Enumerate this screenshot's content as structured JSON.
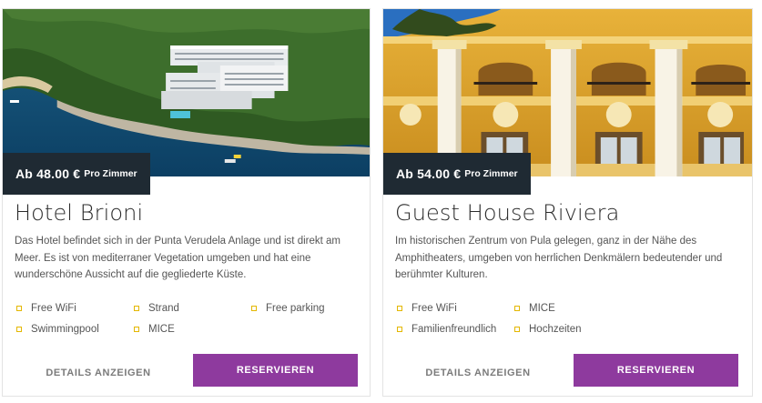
{
  "cards": [
    {
      "price": "Ab 48.00 €",
      "price_unit": "Pro Zimmer",
      "title": "Hotel Brioni",
      "description": "Das Hotel befindet sich in der Punta Verudela Anlage und ist direkt am Meer. Es ist von mediterraner Vegetation umgeben und hat eine wunderschöne Aussicht auf die gegliederte Küste.",
      "features": [
        "Free WiFi",
        "Strand",
        "Free parking",
        "Swimmingpool",
        "MICE"
      ],
      "details_label": "DETAILS ANZEIGEN",
      "reserve_label": "RESERVIEREN"
    },
    {
      "price": "Ab 54.00 €",
      "price_unit": "Pro Zimmer",
      "title": "Guest House Riviera",
      "description": "Im historischen Zentrum von Pula gelegen, ganz in der Nähe des Amphitheaters, umgeben von herrlichen Denkmälern bedeutender und berühmter Kulturen.",
      "features": [
        "Free WiFi",
        "MICE",
        "Familienfreundlich",
        "Hochzeiten"
      ],
      "details_label": "DETAILS ANZEIGEN",
      "reserve_label": "RESERVIEREN"
    }
  ],
  "colors": {
    "badge_bg": "#1f2a33",
    "reserve_bg": "#8e3a9e",
    "bullet": "#e4b700"
  }
}
